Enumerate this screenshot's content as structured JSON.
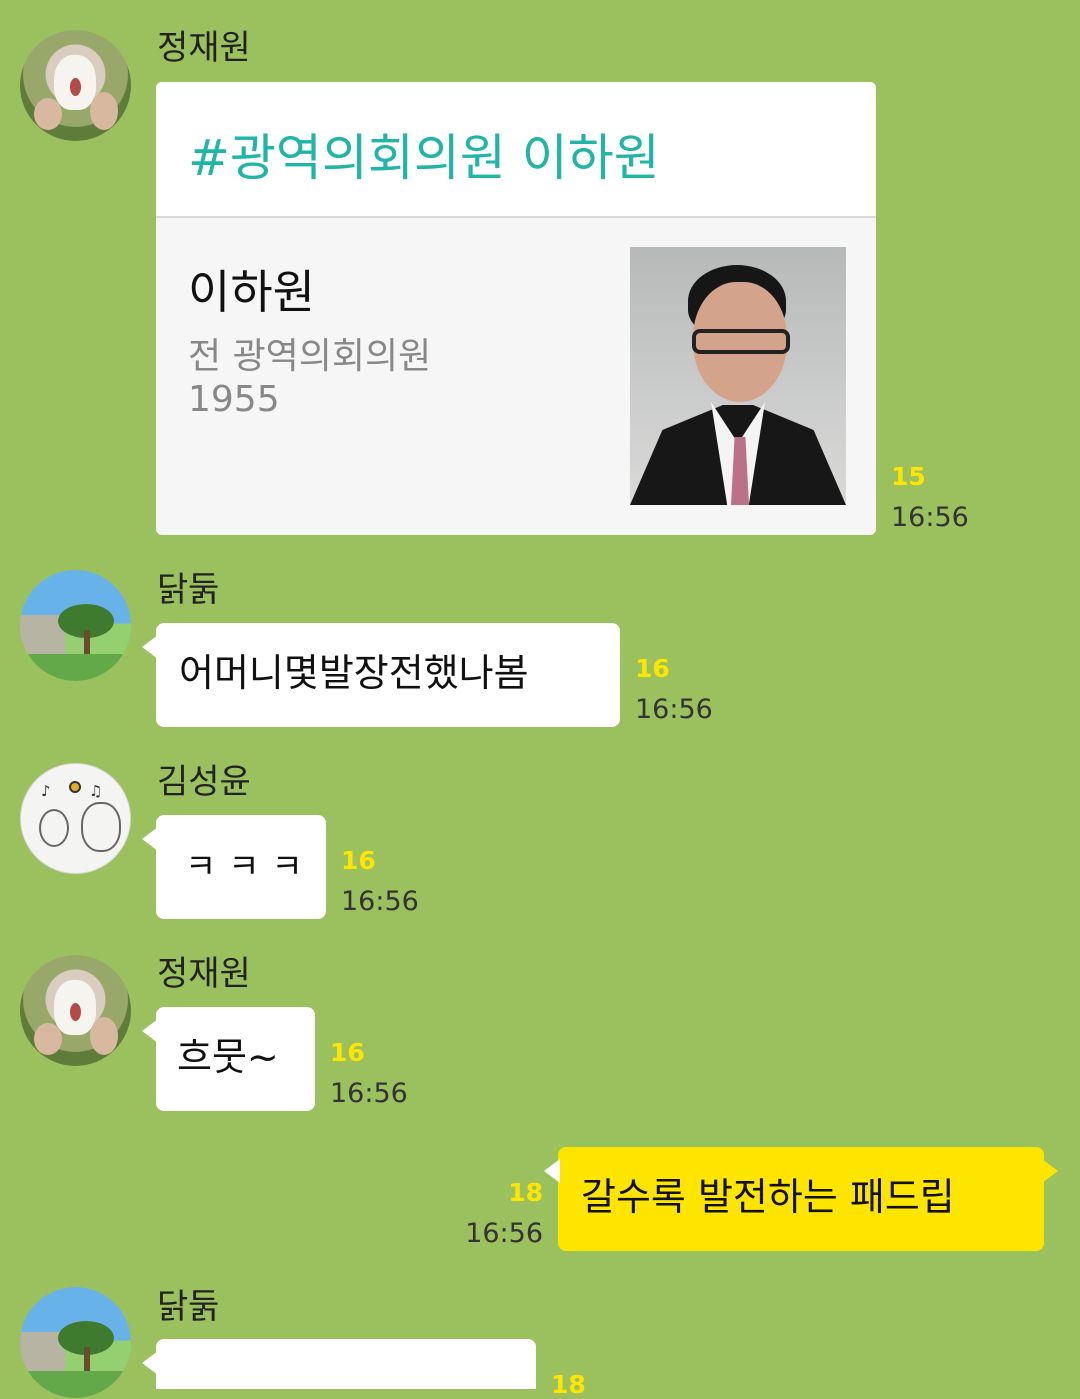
{
  "colors": {
    "background": "#9bc15e",
    "incoming_bubble": "#ffffff",
    "outgoing_bubble": "#fee500",
    "unread_count": "#ffe500",
    "link_title": "#1fb5a7"
  },
  "messages": [
    {
      "sender": "정재원",
      "type": "card",
      "card": {
        "title": "#광역의회의원 이하원",
        "name": "이하원",
        "subtitle": "전 광역의회의원",
        "year": "1955"
      },
      "unread": "15",
      "time": "16:56"
    },
    {
      "sender": "닭둙",
      "text": "어머니몇발장전했나봄",
      "unread": "16",
      "time": "16:56"
    },
    {
      "sender": "김성윤",
      "text": "ㅋㅋㅋ",
      "unread": "16",
      "time": "16:56"
    },
    {
      "sender": "정재원",
      "text": "흐뭇~",
      "unread": "16",
      "time": "16:56"
    },
    {
      "sender": "",
      "text": "갈수록 발전하는 패드립",
      "unread": "18",
      "time": "16:56"
    },
    {
      "sender": "닭둙",
      "text": "",
      "unread": "18",
      "time": ""
    }
  ]
}
